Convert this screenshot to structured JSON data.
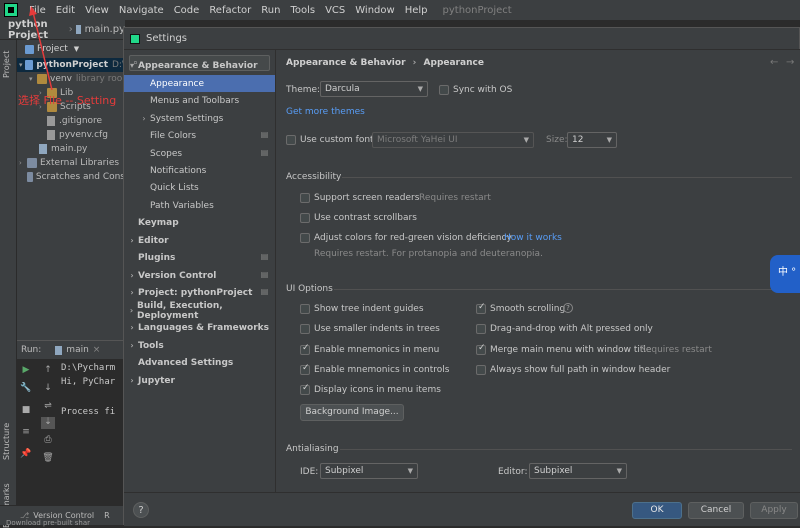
{
  "menubar": {
    "items": [
      "File",
      "Edit",
      "View",
      "Navigate",
      "Code",
      "Refactor",
      "Run",
      "Tools",
      "VCS",
      "Window",
      "Help"
    ],
    "project_title": "pythonProject"
  },
  "crumbbar": {
    "project": "python Project",
    "file": "main.py"
  },
  "left_strip": {
    "project": "Project",
    "structure": "Structure",
    "bookmarks": "Bookmarks"
  },
  "project_panel": {
    "header": "Project",
    "tree": [
      {
        "label": "pythonProject",
        "extra": "D:\\",
        "depth": 0
      },
      {
        "label": "venv",
        "extra": "library roo",
        "depth": 1
      },
      {
        "label": "Lib",
        "extra": "",
        "depth": 2
      },
      {
        "label": "Scripts",
        "extra": "",
        "depth": 2
      },
      {
        "label": ".gitignore",
        "extra": "",
        "depth": 2
      },
      {
        "label": "pyvenv.cfg",
        "extra": "",
        "depth": 2
      },
      {
        "label": "main.py",
        "extra": "",
        "depth": 1
      },
      {
        "label": "External Libraries",
        "extra": "",
        "depth": 0
      },
      {
        "label": "Scratches and Cons",
        "extra": "",
        "depth": 0
      }
    ],
    "annotation": "选择 File -- Setting"
  },
  "run_panel": {
    "label": "Run:",
    "tab": "main",
    "lines": [
      "D:\\Pycharm",
      "Hi, PyChar",
      "",
      "Process fi"
    ]
  },
  "bottombar": {
    "version_control": "Version Control",
    "r": "R",
    "status": "Download pre-built shar"
  },
  "dialog": {
    "title": "Settings",
    "search_placeholder": "",
    "sidebar": [
      {
        "label": "Appearance & Behavior",
        "bold": true,
        "expanded": true,
        "chev": "▾"
      },
      {
        "label": "Appearance",
        "sel": true
      },
      {
        "label": "Menus and Toolbars"
      },
      {
        "label": "System Settings",
        "chev": "›"
      },
      {
        "label": "File Colors",
        "gear": true
      },
      {
        "label": "Scopes",
        "gear": true
      },
      {
        "label": "Notifications"
      },
      {
        "label": "Quick Lists"
      },
      {
        "label": "Path Variables"
      },
      {
        "label": "Keymap",
        "bold": true
      },
      {
        "label": "Editor",
        "bold": true,
        "chev": "›"
      },
      {
        "label": "Plugins",
        "bold": true,
        "gear": true
      },
      {
        "label": "Version Control",
        "bold": true,
        "chev": "›",
        "gear": true
      },
      {
        "label": "Project: pythonProject",
        "bold": true,
        "chev": "›",
        "gear": true
      },
      {
        "label": "Build, Execution, Deployment",
        "bold": true,
        "chev": "›"
      },
      {
        "label": "Languages & Frameworks",
        "bold": true,
        "chev": "›"
      },
      {
        "label": "Tools",
        "bold": true,
        "chev": "›"
      },
      {
        "label": "Advanced Settings",
        "bold": true
      },
      {
        "label": "Jupyter",
        "bold": true,
        "chev": "›"
      }
    ],
    "content": {
      "crumb1": "Appearance & Behavior",
      "crumb_sep": "›",
      "crumb2": "Appearance",
      "theme_label": "Theme:",
      "theme_value": "Darcula",
      "sync_os": "Sync with OS",
      "more_themes": "Get more themes",
      "custom_font": "Use custom font:",
      "font_value": "Microsoft YaHei UI",
      "size_label": "Size:",
      "size_value": "12",
      "accessibility": "Accessibility",
      "screen_readers": "Support screen readers",
      "requires_restart": "Requires restart",
      "contrast_scrollbars": "Use contrast scrollbars",
      "adjust_colors": "Adjust colors for red-green vision deficiency",
      "how_it_works": "How it works",
      "protanopia": "Requires restart. For protanopia and deuteranopia.",
      "ui_options": "UI Options",
      "tree_indent": "Show tree indent guides",
      "smaller_indents": "Use smaller indents in trees",
      "mnemonics_menu": "Enable mnemonics in menu",
      "mnemonics_controls": "Enable mnemonics in controls",
      "icons_menu": "Display icons in menu items",
      "smooth_scrolling": "Smooth scrolling",
      "drag_drop": "Drag-and-drop with Alt pressed only",
      "merge_menu": "Merge main menu with window title",
      "merge_restart": "Requires restart",
      "full_path": "Always show full path in window header",
      "bg_image": "Background Image...",
      "antialiasing": "Antialiasing",
      "ide_label": "IDE:",
      "ide_value": "Subpixel",
      "editor_label": "Editor:",
      "editor_value": "Subpixel"
    },
    "footer": {
      "help": "?",
      "ok": "OK",
      "cancel": "Cancel",
      "apply": "Apply"
    }
  },
  "ime": {
    "text": "中 °"
  },
  "colors": {
    "selection": "#4b6eaf",
    "link": "#589df6",
    "annotation": "#e53b3b"
  }
}
